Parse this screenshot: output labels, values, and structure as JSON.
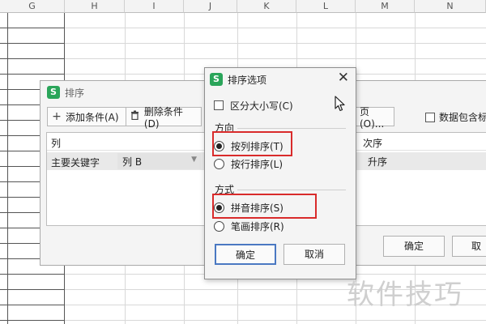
{
  "spreadsheet": {
    "columns": [
      "G",
      "H",
      "I",
      "J",
      "K",
      "L",
      "M",
      "N"
    ]
  },
  "sort_dialog": {
    "title": "排序",
    "toolbar": {
      "add_condition": "添加条件(A)",
      "delete_condition": "删除条件(D)",
      "options_partial": "页(O)...",
      "data_has_header": "数据包含标"
    },
    "headers": {
      "column": "列",
      "order": "次序"
    },
    "row": {
      "key_label": "主要关键字",
      "column_value": "列 B",
      "order_value": "升序"
    },
    "ok_button": "确定",
    "cancel_button": "取"
  },
  "options_dialog": {
    "title": "排序选项",
    "case_sensitive": "区分大小写(C)",
    "direction_label": "方向",
    "direction_options": [
      {
        "label": "按列排序(T)",
        "selected": true
      },
      {
        "label": "按行排序(L)",
        "selected": false
      }
    ],
    "method_label": "方式",
    "method_options": [
      {
        "label": "拼音排序(S)",
        "selected": true
      },
      {
        "label": "笔画排序(R)",
        "selected": false
      }
    ],
    "ok_button": "确定",
    "cancel_button": "取消"
  },
  "watermark": "软件技巧",
  "colors": {
    "highlight": "#d92b2b",
    "app_logo": "#2aa55a"
  }
}
